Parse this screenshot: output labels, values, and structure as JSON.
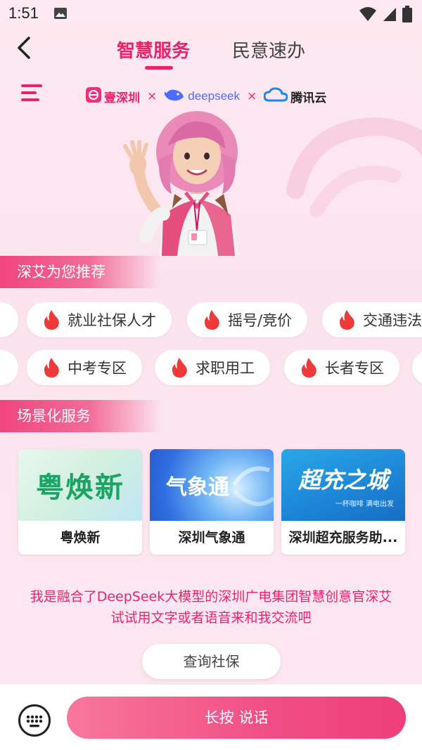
{
  "status_bar": {
    "time": "1:51"
  },
  "header": {
    "tabs": [
      {
        "label": "智慧服务",
        "active": true
      },
      {
        "label": "民意速办",
        "active": false
      }
    ]
  },
  "brands": [
    {
      "name": "壹深圳",
      "icon": "yi-shenzhen-logo"
    },
    {
      "name": "deepseek",
      "icon": "deepseek-whale-logo"
    },
    {
      "name": "腾讯云",
      "icon": "tencent-cloud-logo"
    }
  ],
  "brand_separator": "×",
  "recommend": {
    "title": "深艾为您推荐",
    "row1": [
      "就业社保人才",
      "摇号/竞价",
      "交通违法"
    ],
    "row2": [
      "中考专区",
      "求职用工",
      "长者专区"
    ]
  },
  "scenes": {
    "title": "场景化服务",
    "cards": [
      {
        "label": "粤焕新",
        "banner_text": "粤焕新"
      },
      {
        "label": "深圳气象通",
        "banner_text": "气象通"
      },
      {
        "label": "深圳超充服务助...",
        "banner_text": "超充之城",
        "banner_subtext": "一杯咖啡  满电出发"
      }
    ]
  },
  "intro": {
    "line1": "我是融合了DeepSeek大模型的深圳广电集团智慧创意官深艾",
    "line2": "试试用文字或者语音来和我交流吧"
  },
  "quick_query": "查询社保",
  "bottom": {
    "talk_label": "长按 说话"
  },
  "colors": {
    "accent": "#e8246c",
    "fire": "#ee3a3a"
  }
}
